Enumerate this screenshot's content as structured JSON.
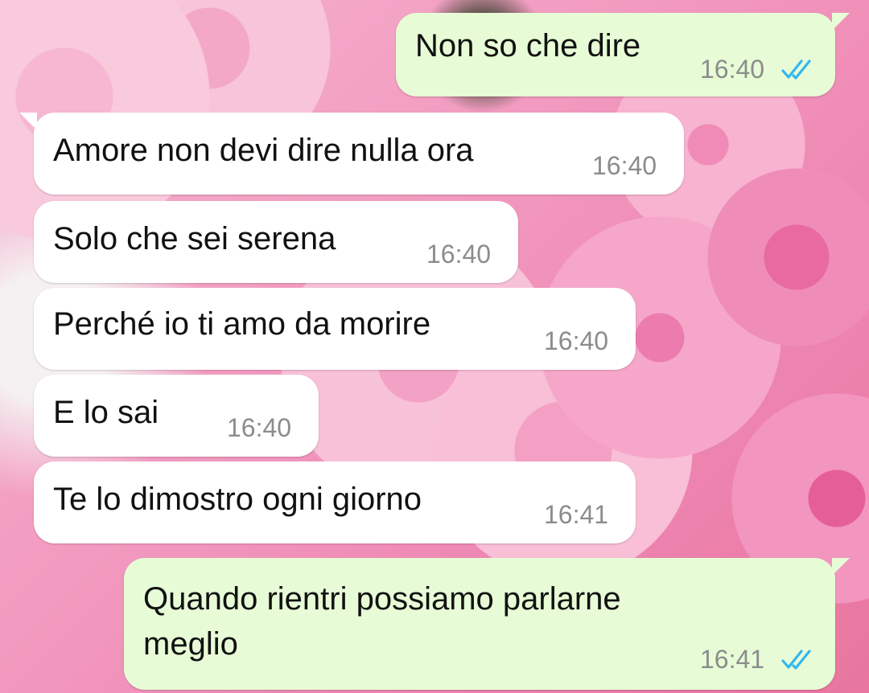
{
  "chat": {
    "messages": [
      {
        "direction": "outgoing",
        "text": "Non so che dire",
        "time": "16:40",
        "status": "read"
      },
      {
        "direction": "incoming",
        "text": "Amore non devi dire nulla ora",
        "time": "16:40"
      },
      {
        "direction": "incoming",
        "text": "Solo che sei serena",
        "time": "16:40"
      },
      {
        "direction": "incoming",
        "text": "Perché io ti amo da morire",
        "time": "16:40"
      },
      {
        "direction": "incoming",
        "text": "E lo sai",
        "time": "16:40"
      },
      {
        "direction": "incoming",
        "text": "Te lo dimostro ogni giorno",
        "time": "16:41"
      },
      {
        "direction": "outgoing",
        "text_line1": " Quando rientri possiamo parlarne",
        "text_line2": "meglio",
        "time": "16:41",
        "status": "read"
      }
    ]
  },
  "icons": {
    "read_receipt": "double-check-icon"
  },
  "colors": {
    "incoming_bubble": "#ffffff",
    "outgoing_bubble": "#e7fcd6",
    "read_tick": "#34b7f1",
    "timestamp": "#8c8c8c"
  }
}
